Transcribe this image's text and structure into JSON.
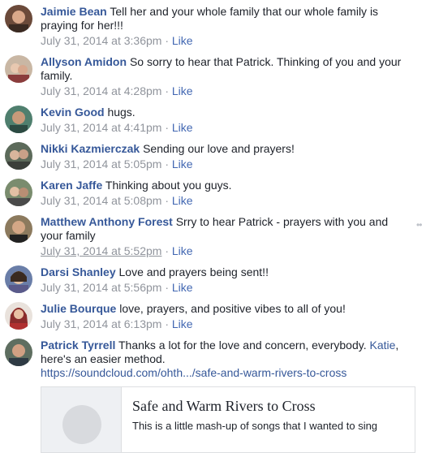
{
  "comments": [
    {
      "author": "Jaimie Bean",
      "text": "Tell her and your whole family that our whole family is praying for her!!!",
      "time": "July 31, 2014 at 3:36pm",
      "like": "Like"
    },
    {
      "author": "Allyson Amidon",
      "text": "So sorry to hear that Patrick. Thinking of you and your family.",
      "time": "July 31, 2014 at 4:28pm",
      "like": "Like"
    },
    {
      "author": "Kevin Good",
      "text": "hugs.",
      "time": "July 31, 2014 at 4:41pm",
      "like": "Like"
    },
    {
      "author": "Nikki Kazmierczak",
      "text": "Sending our love and prayers!",
      "time": "July 31, 2014 at 5:05pm",
      "like": "Like"
    },
    {
      "author": "Karen Jaffe",
      "text": "Thinking about you guys.",
      "time": "July 31, 2014 at 5:08pm",
      "like": "Like"
    },
    {
      "author": "Matthew Anthony Forest",
      "text": "Srry to hear Patrick - prayers with you and your family",
      "time": "July 31, 2014 at 5:52pm",
      "like": "Like"
    },
    {
      "author": "Darsi Shanley",
      "text": "Love and prayers being sent!!",
      "time": "July 31, 2014 at 5:56pm",
      "like": "Like"
    },
    {
      "author": "Julie Bourque",
      "text": "love, prayers, and positive vibes to all of you!",
      "time": "July 31, 2014 at 6:13pm",
      "like": "Like"
    },
    {
      "author": "Patrick Tyrrell",
      "text_before": "Thanks a lot for the love and concern, everybody.",
      "mention": "Katie",
      "text_after": ", here's an easier method.",
      "url": "https://soundcloud.com/ohth.../safe-and-warm-rivers-to-cross"
    }
  ],
  "separator": "·",
  "link_card": {
    "title": "Safe and Warm Rivers to Cross",
    "description": "This is a little mash-up of songs that I wanted to sing"
  },
  "colors": {
    "author": "#365899",
    "meta": "#90949c",
    "like": "#4267b2"
  }
}
